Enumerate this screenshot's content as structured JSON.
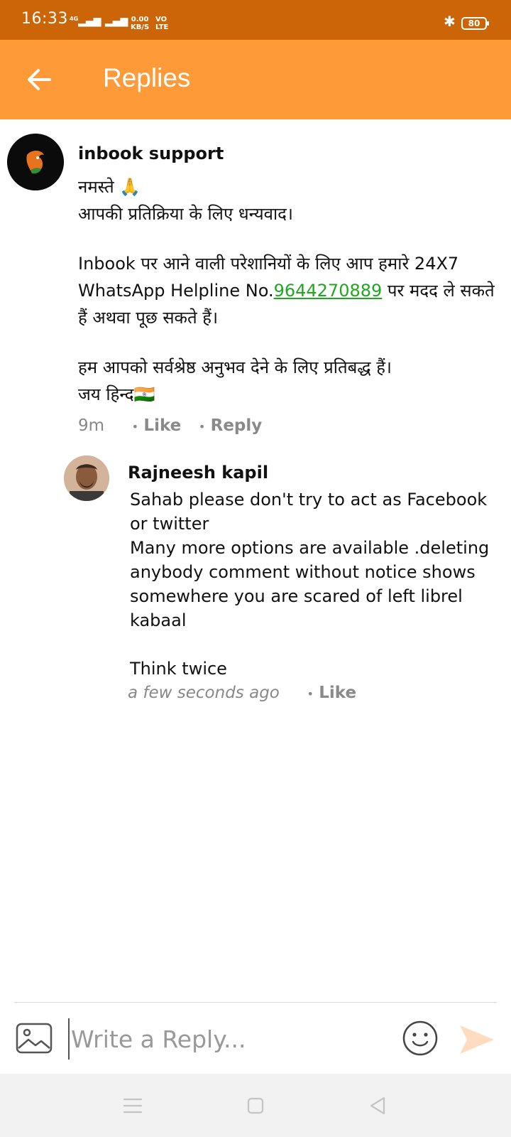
{
  "status_bar": {
    "time": "16:33",
    "signal1": "4G",
    "speed_value": "0.00",
    "speed_unit": "KB/S",
    "volte_top": "VO",
    "volte_bottom": "LTE",
    "battery": "80",
    "icons": [
      "signal-icon",
      "bluetooth-icon",
      "battery-icon"
    ]
  },
  "app_bar": {
    "title": "Replies",
    "icon": "back-arrow-icon"
  },
  "comments": [
    {
      "author": "inbook support",
      "lines": {
        "greeting": "नमस्ते 🙏",
        "thanks": "आपकी प्रतिक्रिया के लिए धन्यवाद।",
        "help_prefix": "Inbook पर आने वाली परेशानियों के लिए आप हमारे 24X7 WhatsApp Helpline No.",
        "phone": "9644270889",
        "help_suffix": " पर मदद ले सकते हैं अथवा पूछ सकते हैं।",
        "commitment": "हम आपको सर्वश्रेष्ठ अनुभव देने के लिए प्रतिबद्ध हैं।",
        "jai_hind": "जय हिन्द🇮🇳"
      },
      "time": "9m",
      "like_label": "Like",
      "reply_label": "Reply"
    },
    {
      "author": "Rajneesh  kapil",
      "lines": {
        "p1": "Sahab please don't try to act as Facebook or twitter",
        "p2": "Many more options are available .deleting anybody comment without notice shows somewhere you are scared of left librel kabaal",
        "p3": "Think twice"
      },
      "time": "a few seconds ago",
      "like_label": "Like"
    }
  ],
  "composer": {
    "placeholder": "Write a Reply...",
    "icons": [
      "image-icon",
      "emoji-icon",
      "send-icon"
    ]
  },
  "colors": {
    "status_bar": "#cc6508",
    "app_bar": "#ff9a38",
    "link": "#1fa81f",
    "send": "#ffd9b8"
  }
}
